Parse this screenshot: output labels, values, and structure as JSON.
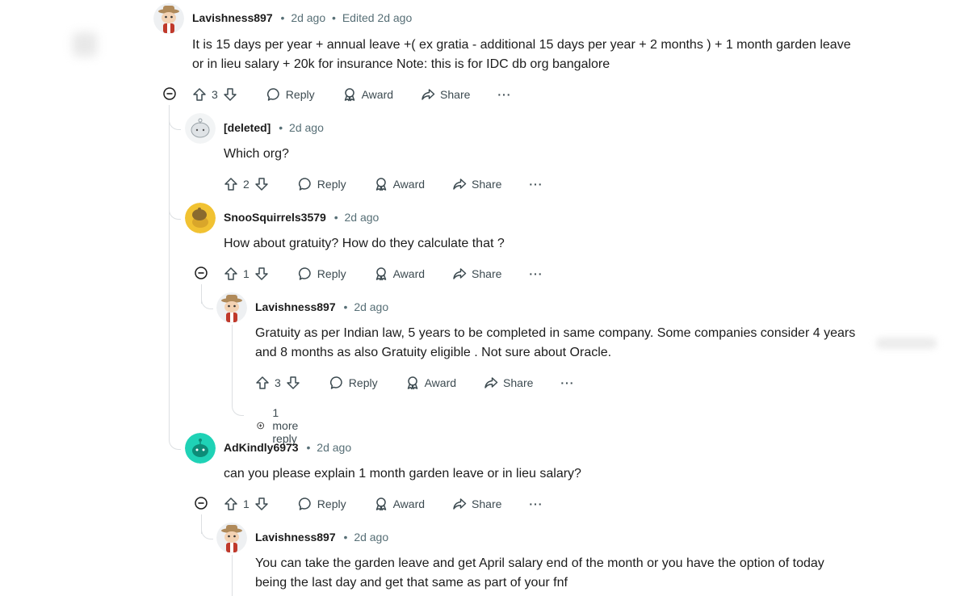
{
  "comments": [
    {
      "author": "Lavishness897",
      "time": "2d ago",
      "edited": "Edited 2d ago",
      "text": "It is 15 days per year + annual leave +( ex gratia - additional 15 days per year + 2 months ) + 1 month garden leave or in lieu salary + 20k for insurance Note: this is for IDC db org bangalore",
      "votes": "3"
    },
    {
      "author": "[deleted]",
      "time": "2d ago",
      "text": "Which org?",
      "votes": "2"
    },
    {
      "author": "SnooSquirrels3579",
      "time": "2d ago",
      "text": "How about gratuity? How do they calculate that ?",
      "votes": "1"
    },
    {
      "author": "Lavishness897",
      "time": "2d ago",
      "text": "Gratuity as per Indian law, 5 years to be completed in same company. Some companies consider 4 years and 8 months as also Gratuity eligible . Not sure about Oracle.",
      "votes": "3"
    },
    {
      "author": "AdKindly6973",
      "time": "2d ago",
      "text": "can you please explain 1 month garden leave or in lieu salary?",
      "votes": "1"
    },
    {
      "author": "Lavishness897",
      "time": "2d ago",
      "text": "You can take the garden leave and get April salary end of the month or you have the option of today being the last day and get that same as part of your fnf"
    }
  ],
  "actions": {
    "reply": "Reply",
    "award": "Award",
    "share": "Share",
    "more": "···"
  },
  "separator": "•",
  "more_replies": "1 more reply",
  "colors": {
    "snoo_yellow": "#f1c232",
    "snoo_teal": "#1fd2b6",
    "text": "#1c1c1c",
    "meta": "#576f76",
    "thread": "#dcdfe2"
  }
}
